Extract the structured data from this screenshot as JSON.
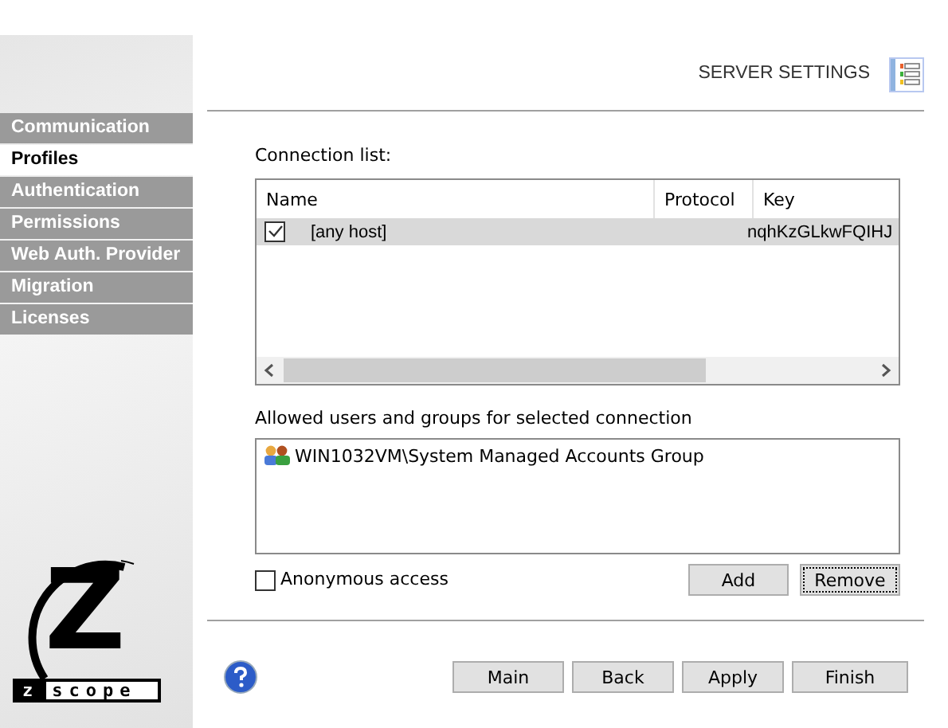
{
  "header": {
    "title": "SERVER SETTINGS"
  },
  "sidebar": {
    "items": [
      {
        "label": "Communication",
        "selected": false
      },
      {
        "label": "Profiles",
        "selected": true
      },
      {
        "label": "Authentication",
        "selected": false
      },
      {
        "label": "Permissions",
        "selected": false
      },
      {
        "label": "Web Auth. Provider",
        "selected": false
      },
      {
        "label": "Migration",
        "selected": false
      },
      {
        "label": "Licenses",
        "selected": false
      }
    ]
  },
  "logo": {
    "letter": "Z",
    "wordmark_left": "z",
    "wordmark_right": "scope"
  },
  "connection_list": {
    "label": "Connection list:",
    "columns": [
      "Name",
      "Protocol",
      "Key"
    ],
    "rows": [
      {
        "checked": true,
        "selected": true,
        "name": "[any host]",
        "protocol": "",
        "key": "nqhKzGLkwFQIHJ"
      }
    ]
  },
  "users": {
    "label": "Allowed users and groups for selected  connection",
    "items": [
      "WIN1032VM\\System Managed Accounts Group"
    ]
  },
  "anonymous_access": {
    "label": "Anonymous access",
    "checked": false
  },
  "list_buttons": [
    {
      "label": "Add",
      "focused": false
    },
    {
      "label": "Remove",
      "focused": true
    }
  ],
  "footer_buttons": [
    "Main",
    "Back",
    "Apply",
    "Finish"
  ]
}
